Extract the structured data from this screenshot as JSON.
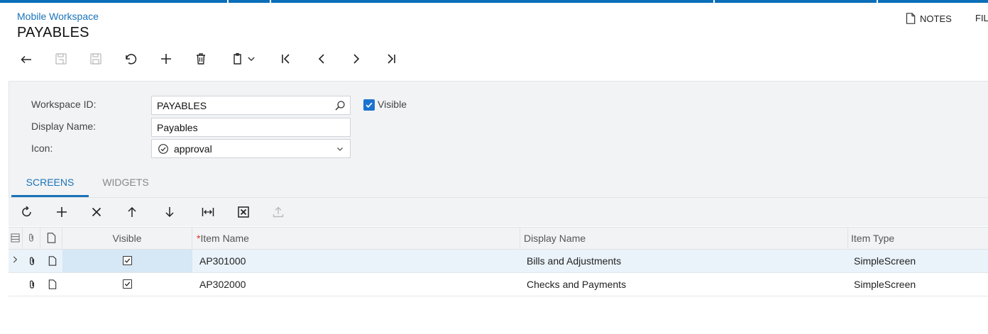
{
  "header": {
    "breadcrumb": "Mobile Workspace",
    "title": "PAYABLES",
    "notes_label": "NOTES",
    "files_label": "FIL"
  },
  "toolbar": {
    "buttons": [
      "back-icon",
      "save-close-icon",
      "save-icon",
      "undo-icon",
      "add-icon",
      "delete-icon",
      "copy-paste-icon",
      "first-record-icon",
      "previous-record-icon",
      "next-record-icon",
      "last-record-icon"
    ]
  },
  "form": {
    "workspace_id_label": "Workspace ID:",
    "workspace_id_value": "PAYABLES",
    "display_name_label": "Display Name:",
    "display_name_value": "Payables",
    "icon_label": "Icon:",
    "icon_value": "approval",
    "visible_label": "Visible",
    "visible_checked": true
  },
  "tabs": [
    {
      "label": "SCREENS",
      "active": true
    },
    {
      "label": "WIDGETS",
      "active": false
    }
  ],
  "grid": {
    "toolbar_buttons": [
      "refresh-icon",
      "add-row-icon",
      "delete-row-icon",
      "move-up-icon",
      "move-down-icon",
      "fit-columns-icon",
      "export-excel-icon",
      "upload-icon"
    ],
    "columns": {
      "visible": "Visible",
      "item_name": "Item Name",
      "display_name": "Display Name",
      "item_type": "Item Type"
    },
    "required_marker": "*",
    "rows": [
      {
        "visible": true,
        "item_name": "AP301000",
        "display_name": "Bills and Adjustments",
        "item_type": "SimpleScreen",
        "selected": true
      },
      {
        "visible": true,
        "item_name": "AP302000",
        "display_name": "Checks and Payments",
        "item_type": "SimpleScreen",
        "selected": false
      }
    ]
  },
  "colors": {
    "accent": "#1a73b8",
    "topbar": "#0a6fb8",
    "panel_bg": "#f2f3f5",
    "checkbox_blue": "#1a73d0",
    "selected_row": "#eaf3fa"
  }
}
